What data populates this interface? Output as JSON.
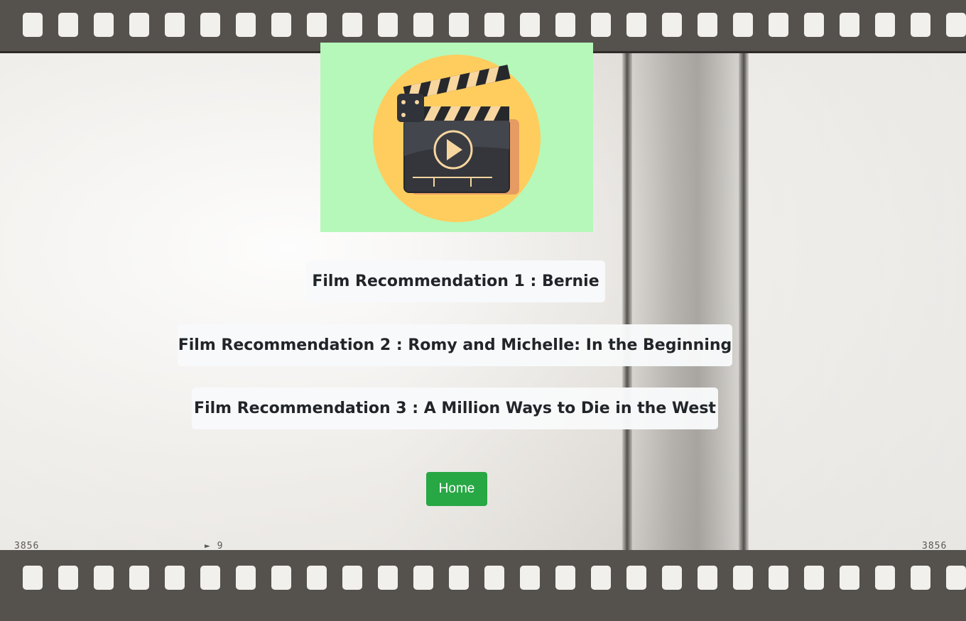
{
  "logo": {
    "icon": "clapperboard-play-icon",
    "background_color": "#b5f8b9"
  },
  "recommendations": [
    {
      "text": "Film Recommendation 1 : Bernie"
    },
    {
      "text": "Film Recommendation 2 : Romy and Michelle: In the Beginning"
    },
    {
      "text": "Film Recommendation 3 : A Million Ways to Die in the West"
    }
  ],
  "home_button": {
    "label": "Home",
    "color": "#28a745"
  },
  "background": {
    "frame_numbers": [
      "3856",
      "9",
      "3856"
    ]
  }
}
